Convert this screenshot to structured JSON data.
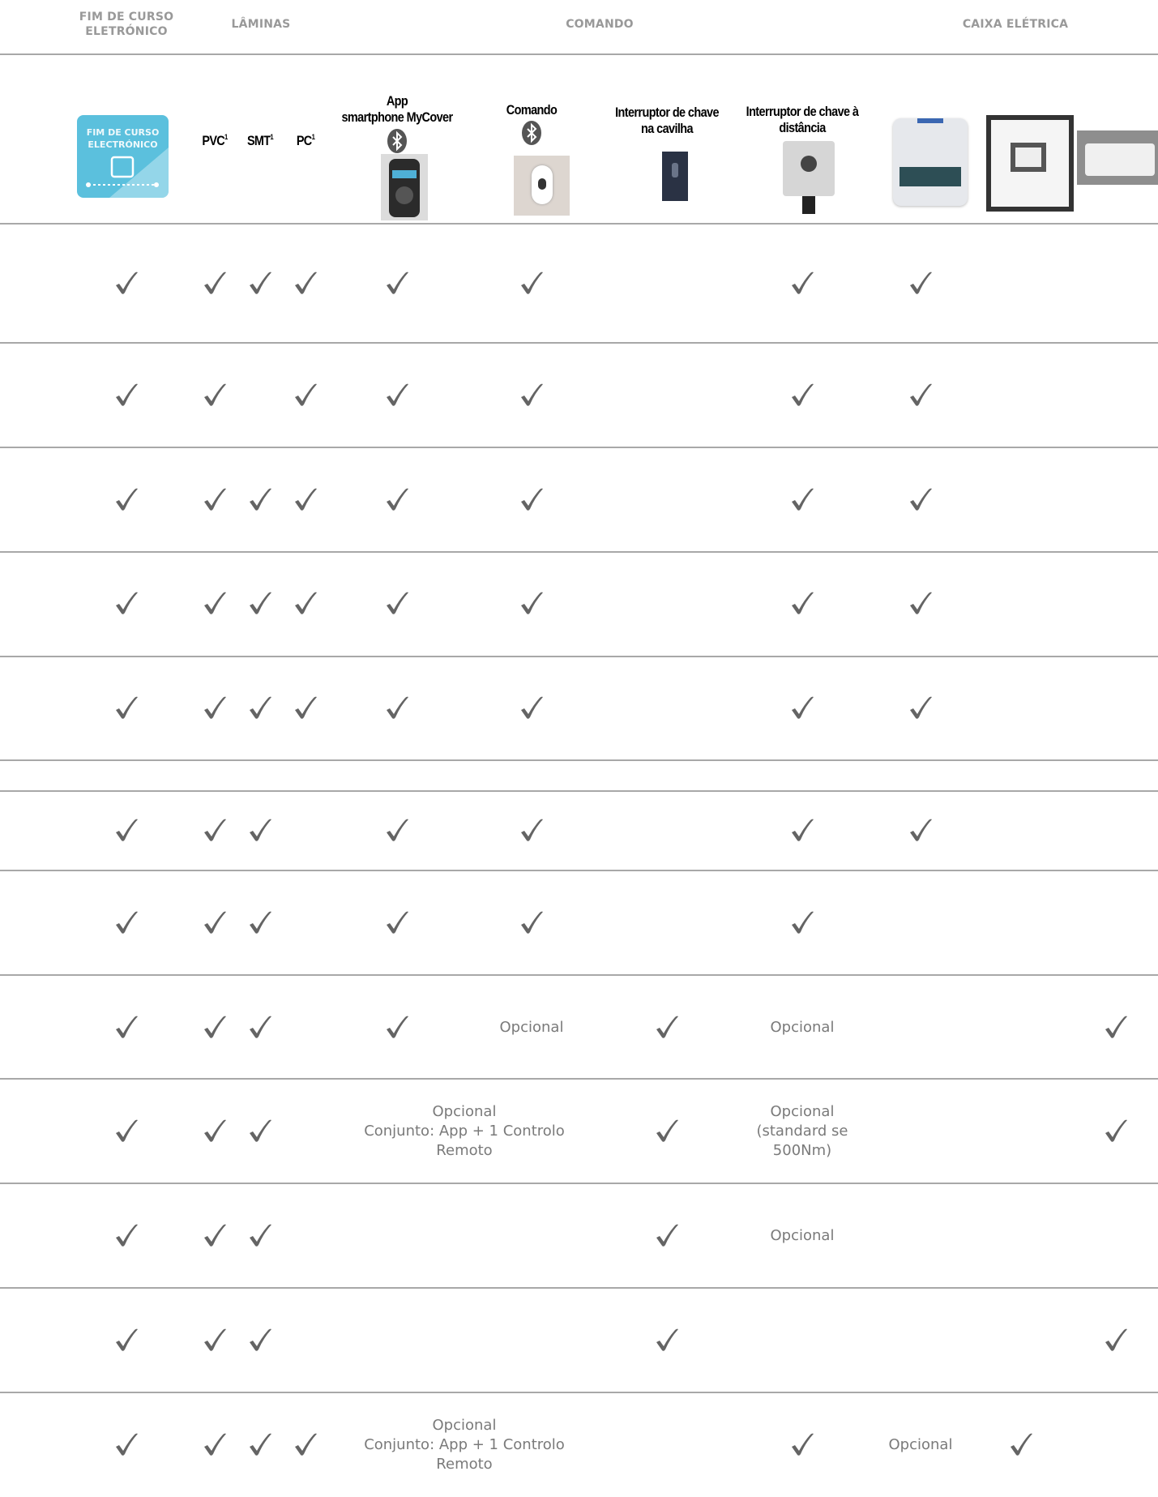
{
  "header": {
    "groups": {
      "fim_de_curso": "FIM DE CURSO\nELETRÓNICO",
      "laminas": "LÂMINAS",
      "comando": "COMANDO",
      "caixa_eletrica": "CAIXA ELÉTRICA"
    },
    "columns": {
      "pvc": "PVC",
      "smt": "SMT",
      "pc": "PC",
      "footnote_mark": "1",
      "app": "App\nsmartphone MyCover",
      "comando": "Comando",
      "interruptor_cavilha": "Interruptor de chave\nna cavilha",
      "interruptor_distancia": "Interruptor de chave à\ndistância"
    },
    "fim_de_curso_badge": "FIM DE CURSO\nELECTRÓNICO"
  },
  "table": {
    "check_symbol": "✓",
    "rows": [
      {
        "fim": "✓",
        "pvc": "✓",
        "smt": "✓",
        "pc": "✓",
        "app": "✓",
        "comando": "✓",
        "int_dist": "✓",
        "caixa1": "✓"
      },
      {
        "fim": "✓",
        "pvc": "✓",
        "pc": "✓",
        "app": "✓",
        "comando": "✓",
        "int_dist": "✓",
        "caixa1": "✓"
      },
      {
        "fim": "✓",
        "pvc": "✓",
        "smt": "✓",
        "pc": "✓",
        "app": "✓",
        "comando": "✓",
        "int_dist": "✓",
        "caixa1": "✓"
      },
      {
        "fim": "✓",
        "pvc": "✓",
        "smt": "✓",
        "pc": "✓",
        "app": "✓",
        "comando": "✓",
        "int_dist": "✓",
        "caixa1": "✓"
      },
      {
        "fim": "✓",
        "pvc": "✓",
        "smt": "✓",
        "pc": "✓",
        "app": "✓",
        "comando": "✓",
        "int_dist": "✓",
        "caixa1": "✓"
      },
      {
        "fim": "✓",
        "pvc": "✓",
        "smt": "✓",
        "app": "✓",
        "comando": "✓",
        "int_dist": "✓",
        "caixa1": "✓"
      },
      {
        "fim": "✓",
        "pvc": "✓",
        "smt": "✓",
        "app": "✓",
        "comando": "✓",
        "int_dist": "✓"
      },
      {
        "fim": "✓",
        "pvc": "✓",
        "smt": "✓",
        "app": "✓",
        "comando": "Opcional",
        "int_cav": "✓",
        "int_dist": "Opcional",
        "caixa3": "✓"
      },
      {
        "fim": "✓",
        "pvc": "✓",
        "smt": "✓",
        "app_comando": "Opcional\nConjunto: App + 1 Controlo\nRemoto",
        "int_cav": "✓",
        "int_dist": "Opcional\n(standard se\n500Nm)",
        "caixa3": "✓"
      },
      {
        "fim": "✓",
        "pvc": "✓",
        "smt": "✓",
        "int_cav": "✓",
        "int_dist": "Opcional"
      },
      {
        "fim": "✓",
        "pvc": "✓",
        "smt": "✓",
        "int_cav": "✓",
        "caixa3": "✓"
      },
      {
        "fim": "✓",
        "pvc": "✓",
        "smt": "✓",
        "pc": "✓",
        "app_comando": "Opcional\nConjunto: App + 1 Controlo\nRemoto",
        "int_dist": "✓",
        "caixa1": "Opcional",
        "caixa2": "✓"
      }
    ]
  },
  "colors": {
    "check": "#646464",
    "rule": "#a8a8a8",
    "group_header": "#999999",
    "badge_blue": "#5bc0dd"
  }
}
